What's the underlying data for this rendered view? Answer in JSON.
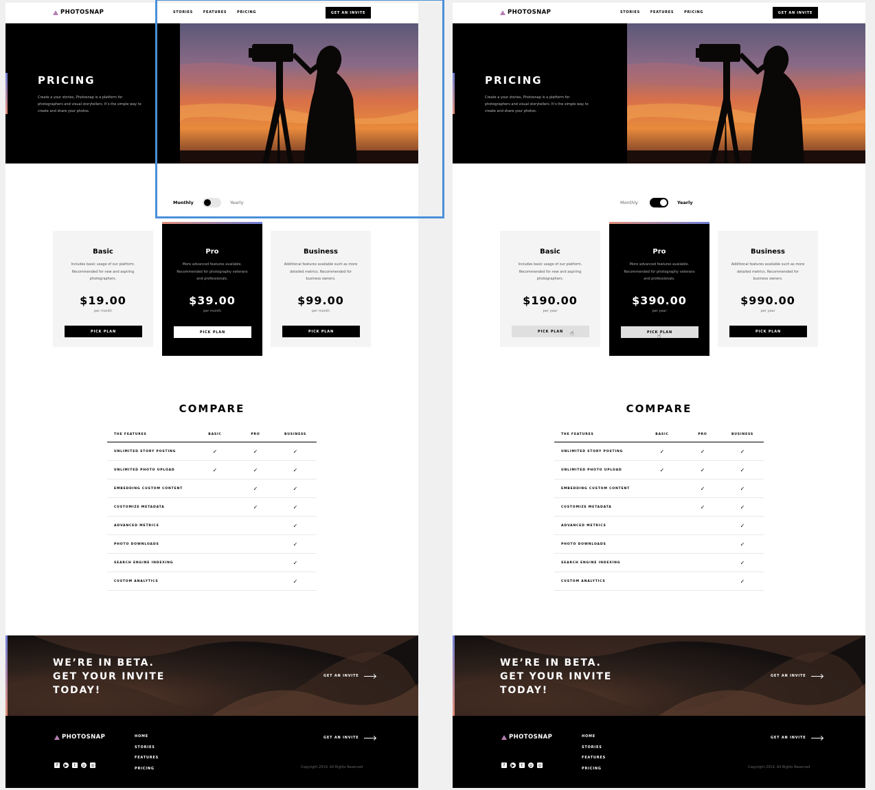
{
  "brand": {
    "name": "PHOTOSNAP"
  },
  "nav": {
    "links": [
      "STORIES",
      "FEATURES",
      "PRICING"
    ],
    "cta": "GET AN INVITE"
  },
  "hero": {
    "title": "PRICING",
    "description": "Create a your stories, Photosnap is a platform for photographers and visual storytellers. It’s the simple way to create and share your photos."
  },
  "billing": {
    "monthly_label": "Monthly",
    "yearly_label": "Yearly"
  },
  "plans": [
    {
      "name": "Basic",
      "description": "Includes basic usage of our platform. Recommended for new and aspiring photographers."
    },
    {
      "name": "Pro",
      "description": "More advanced features available. Recommended for photography veterans and professionals."
    },
    {
      "name": "Business",
      "description": "Additional features available such as more detailed metrics. Recommended for business owners."
    }
  ],
  "screens": [
    {
      "billing_selected": "Monthly",
      "prices": [
        "$19.00",
        "$39.00",
        "$99.00"
      ],
      "period": "per month",
      "button": "PICK PLAN"
    },
    {
      "billing_selected": "Yearly",
      "prices": [
        "$190.00",
        "$390.00",
        "$990.00"
      ],
      "period": "per year",
      "button": "PICK PLAN"
    }
  ],
  "compare": {
    "title": "COMPARE",
    "headers": [
      "THE FEATURES",
      "BASIC",
      "PRO",
      "BUSINESS"
    ],
    "check_symbol": "✓",
    "rows": [
      {
        "feature": "UNLIMITED STORY POSTING",
        "basic": true,
        "pro": true,
        "business": true
      },
      {
        "feature": "UNLIMITED PHOTO UPLOAD",
        "basic": true,
        "pro": true,
        "business": true
      },
      {
        "feature": "EMBEDDING CUSTOM CONTENT",
        "basic": false,
        "pro": true,
        "business": true
      },
      {
        "feature": "CUSTOMIZE METADATA",
        "basic": false,
        "pro": true,
        "business": true
      },
      {
        "feature": "ADVANCED METRICS",
        "basic": false,
        "pro": false,
        "business": true
      },
      {
        "feature": "PHOTO DOWNLOADS",
        "basic": false,
        "pro": false,
        "business": true
      },
      {
        "feature": "SEARCH ENGINE INDEXING",
        "basic": false,
        "pro": false,
        "business": true
      },
      {
        "feature": "CUSTOM ANALYTICS",
        "basic": false,
        "pro": false,
        "business": true
      }
    ]
  },
  "beta": {
    "title_lines": [
      "WE’RE IN BETA.",
      "GET YOUR INVITE",
      "TODAY!"
    ],
    "link": "GET AN INVITE"
  },
  "footer": {
    "links": [
      "HOME",
      "STORIES",
      "FEATURES",
      "PRICING"
    ],
    "cta": "GET AN INVITE",
    "social_icons": [
      "facebook-icon",
      "youtube-icon",
      "twitter-icon",
      "pinterest-icon",
      "instagram-icon"
    ],
    "copyright": "Copyright 2019. All Rights Reserved"
  },
  "colors": {
    "accent_pink": "#b67eb5",
    "accent_blue": "#6f7fd8",
    "accent_orange": "#e38f79",
    "selection": "#4a90d9"
  }
}
